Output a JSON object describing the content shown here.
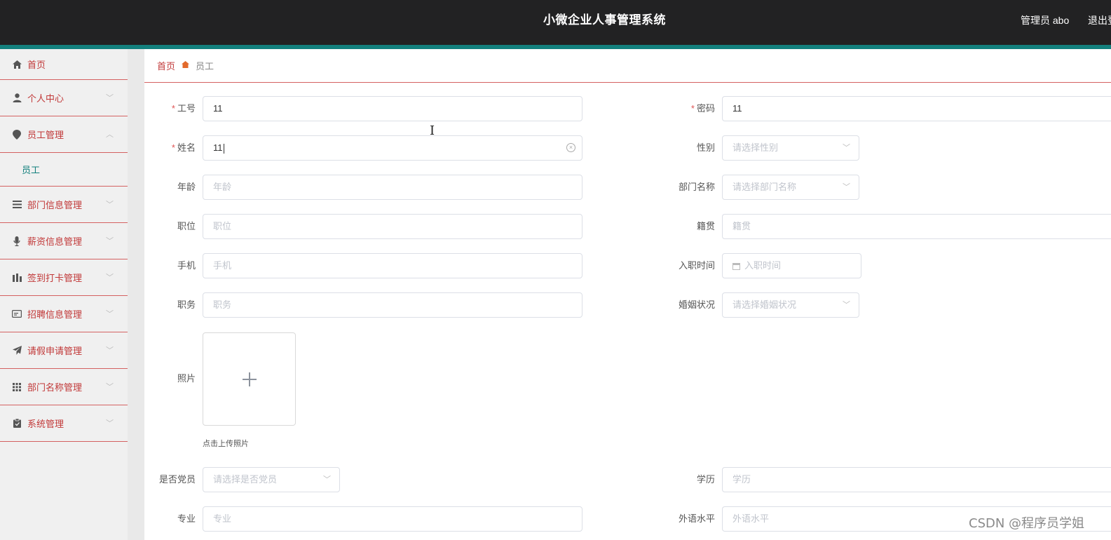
{
  "header": {
    "title": "小微企业人事管理系统",
    "user": "管理员 abo",
    "logout": "退出登录"
  },
  "sidebar": {
    "items": [
      {
        "label": "首页",
        "icon": "home-icon"
      },
      {
        "label": "个人中心",
        "icon": "user-icon",
        "chevron": "﹀"
      },
      {
        "label": "员工管理",
        "icon": "location-icon",
        "chevron": "︿",
        "expanded": true
      },
      {
        "label": "员工",
        "sub": true
      },
      {
        "label": "部门信息管理",
        "icon": "menu-icon",
        "chevron": "﹀"
      },
      {
        "label": "薪资信息管理",
        "icon": "microphone-icon",
        "chevron": "﹀"
      },
      {
        "label": "签到打卡管理",
        "icon": "chart-icon",
        "chevron": "﹀"
      },
      {
        "label": "招聘信息管理",
        "icon": "card-icon",
        "chevron": "﹀"
      },
      {
        "label": "请假申请管理",
        "icon": "send-icon",
        "chevron": "﹀"
      },
      {
        "label": "部门名称管理",
        "icon": "grid-icon",
        "chevron": "﹀"
      },
      {
        "label": "系统管理",
        "icon": "clipboard-icon",
        "chevron": "﹀"
      }
    ]
  },
  "breadcrumb": {
    "home": "首页",
    "separator_icon": "home-fill-icon",
    "current": "员工"
  },
  "form": {
    "employee_no": {
      "label": "工号",
      "value": "11",
      "required": true
    },
    "password": {
      "label": "密码",
      "value": "11",
      "required": true
    },
    "name": {
      "label": "姓名",
      "value": "11",
      "required": true
    },
    "gender": {
      "label": "性别",
      "placeholder": "请选择性别"
    },
    "age": {
      "label": "年龄",
      "placeholder": "年龄"
    },
    "department": {
      "label": "部门名称",
      "placeholder": "请选择部门名称"
    },
    "position": {
      "label": "职位",
      "placeholder": "职位"
    },
    "hometown": {
      "label": "籍贯",
      "placeholder": "籍贯"
    },
    "phone": {
      "label": "手机",
      "placeholder": "手机"
    },
    "hire_date": {
      "label": "入职时间",
      "placeholder": "入职时间"
    },
    "duty": {
      "label": "职务",
      "placeholder": "职务"
    },
    "marital": {
      "label": "婚姻状况",
      "placeholder": "请选择婚姻状况"
    },
    "photo": {
      "label": "照片",
      "tip": "点击上传照片"
    },
    "party_member": {
      "label": "是否党员",
      "placeholder": "请选择是否党员"
    },
    "education": {
      "label": "学历",
      "placeholder": "学历"
    },
    "major": {
      "label": "专业",
      "placeholder": "专业"
    },
    "language": {
      "label": "外语水平",
      "placeholder": "外语水平"
    }
  },
  "watermark": "CSDN @程序员学姐",
  "colors": {
    "topbar": "#222223",
    "accent": "#13807d",
    "menu_text": "#c13838",
    "divider": "#d46161"
  }
}
